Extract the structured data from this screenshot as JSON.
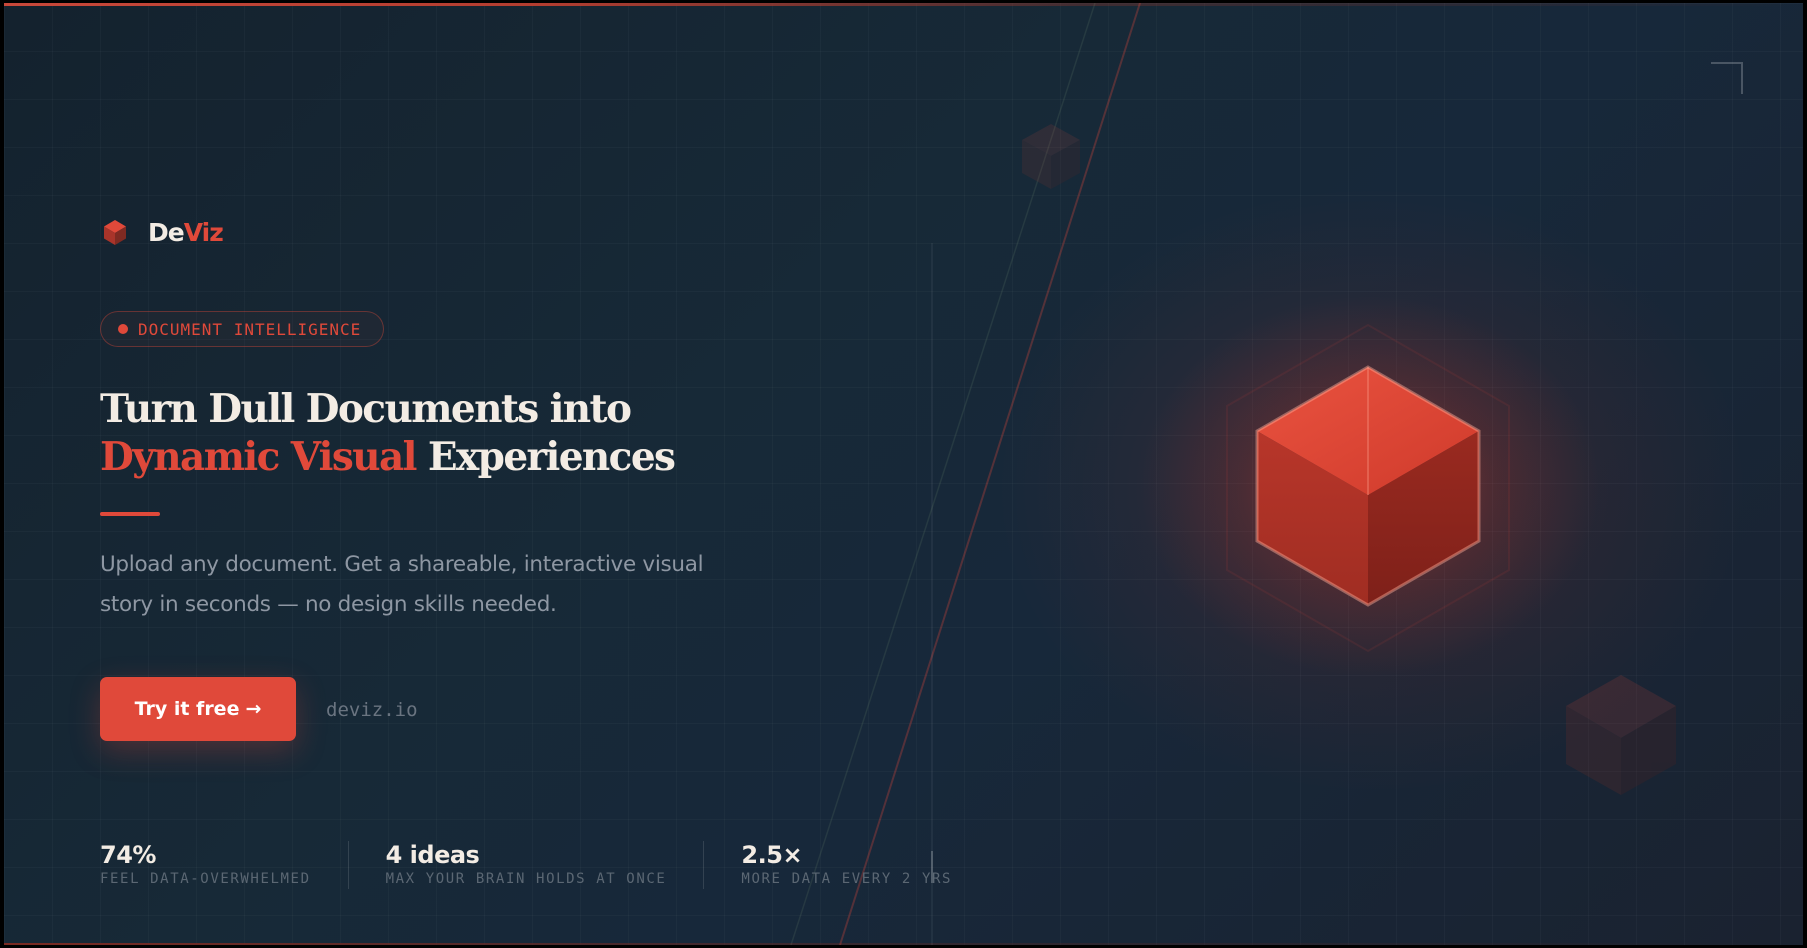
{
  "brand": {
    "name_part1": "De",
    "name_part2": "Viz",
    "logo_icon": "cube-icon",
    "accent_color": "#e0493a",
    "text_color": "#f3ece4",
    "background_color": "#172937"
  },
  "hero": {
    "tag": "DOCUMENT INTELLIGENCE",
    "headline_line1": "Turn Dull Documents into",
    "headline_accent": "Dynamic Visual",
    "headline_rest": "Experiences",
    "subheadline": "Upload any document. Get a shareable, interactive visual story in seconds — no design skills needed.",
    "cta_label": "Try it free",
    "cta_arrow": "→",
    "domain": "deviz.io",
    "visual_icon": "cube-icon"
  },
  "stats": [
    {
      "value": "74%",
      "label": "FEEL DATA-OVERWHELMED"
    },
    {
      "value": "4 ideas",
      "label": "MAX YOUR BRAIN HOLDS AT ONCE"
    },
    {
      "value": "2.5×",
      "label": "MORE DATA EVERY 2 YRS"
    }
  ]
}
